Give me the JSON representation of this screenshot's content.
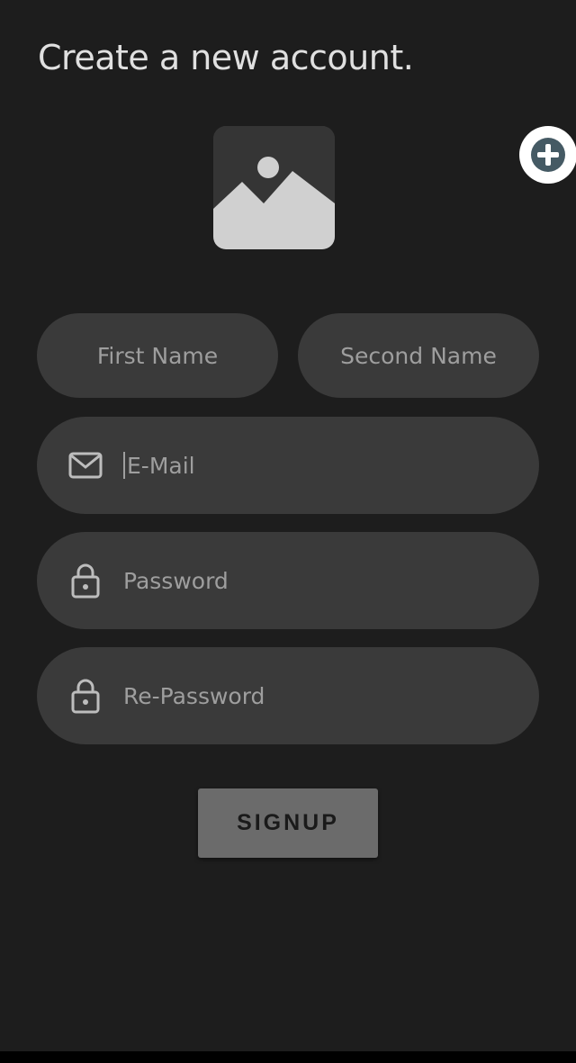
{
  "header": {
    "title": "Create a new account."
  },
  "avatar": {
    "icon": "image-add-icon",
    "badge_icon": "plus-icon"
  },
  "form": {
    "first_name_placeholder": "First Name",
    "second_name_placeholder": "Second Name",
    "email_placeholder": "E-Mail",
    "password_placeholder": "Password",
    "repassword_placeholder": "Re-Password",
    "email_icon": "mail-icon",
    "password_icon": "lock-icon",
    "repassword_icon": "lock-icon"
  },
  "actions": {
    "signup_label": "SIGNUP"
  },
  "colors": {
    "background": "#1d1d1d",
    "field": "#3a3a3a",
    "button": "#6b6b6b",
    "badge_plus": "#455a64"
  }
}
